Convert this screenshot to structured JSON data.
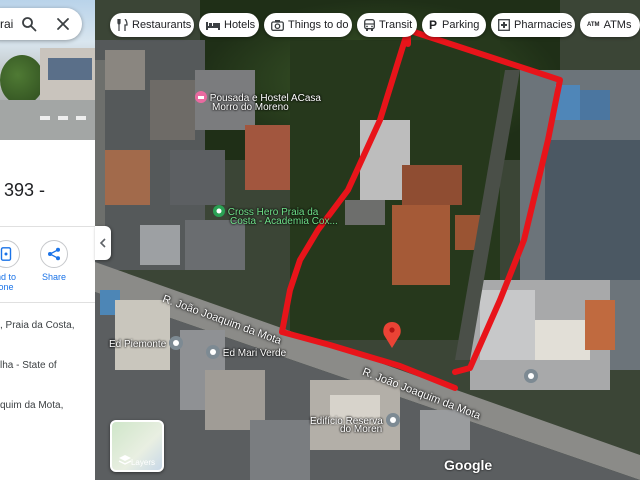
{
  "search": {
    "text": "rai"
  },
  "place": {
    "title": ", 393 -",
    "actions": [
      {
        "label_1": "nd to",
        "label_2": "one"
      },
      {
        "label": "Share"
      }
    ],
    "address_lines": [
      ", Praia da Costa,",
      "lha - State of",
      "quim da Mota,"
    ]
  },
  "chips": [
    {
      "label": "Restaurants",
      "icon": "fork-knife-icon"
    },
    {
      "label": "Hotels",
      "icon": "bed-icon"
    },
    {
      "label": "Things to do",
      "icon": "camera-icon"
    },
    {
      "label": "Transit",
      "icon": "bus-icon"
    },
    {
      "label": "Parking",
      "icon": "parking-icon"
    },
    {
      "label": "Pharmacies",
      "icon": "pharmacy-icon"
    },
    {
      "label": "ATMs",
      "icon": "atm-icon"
    }
  ],
  "map": {
    "places": {
      "pousada_1": "Pousada e Hostel ACasa",
      "pousada_2": "Morro do Moreno",
      "crosshero_1": "Cross Hero Praia da",
      "crosshero_2": "Costa - Academia Cox...",
      "ed_piemonte": "Ed Piemonte",
      "ed_mari_verde": "Ed Mari Verde",
      "edificio_1": "Edifício Reserva",
      "edificio_2": "do Moren"
    },
    "streets": {
      "upper": "R. João Joaquim da Mota",
      "lower": "R. João Joaquim da Mota"
    },
    "layers_label": "Layers",
    "attribution": "Google",
    "outline_color": "#e8141a",
    "pin_color": "#ea4335"
  }
}
